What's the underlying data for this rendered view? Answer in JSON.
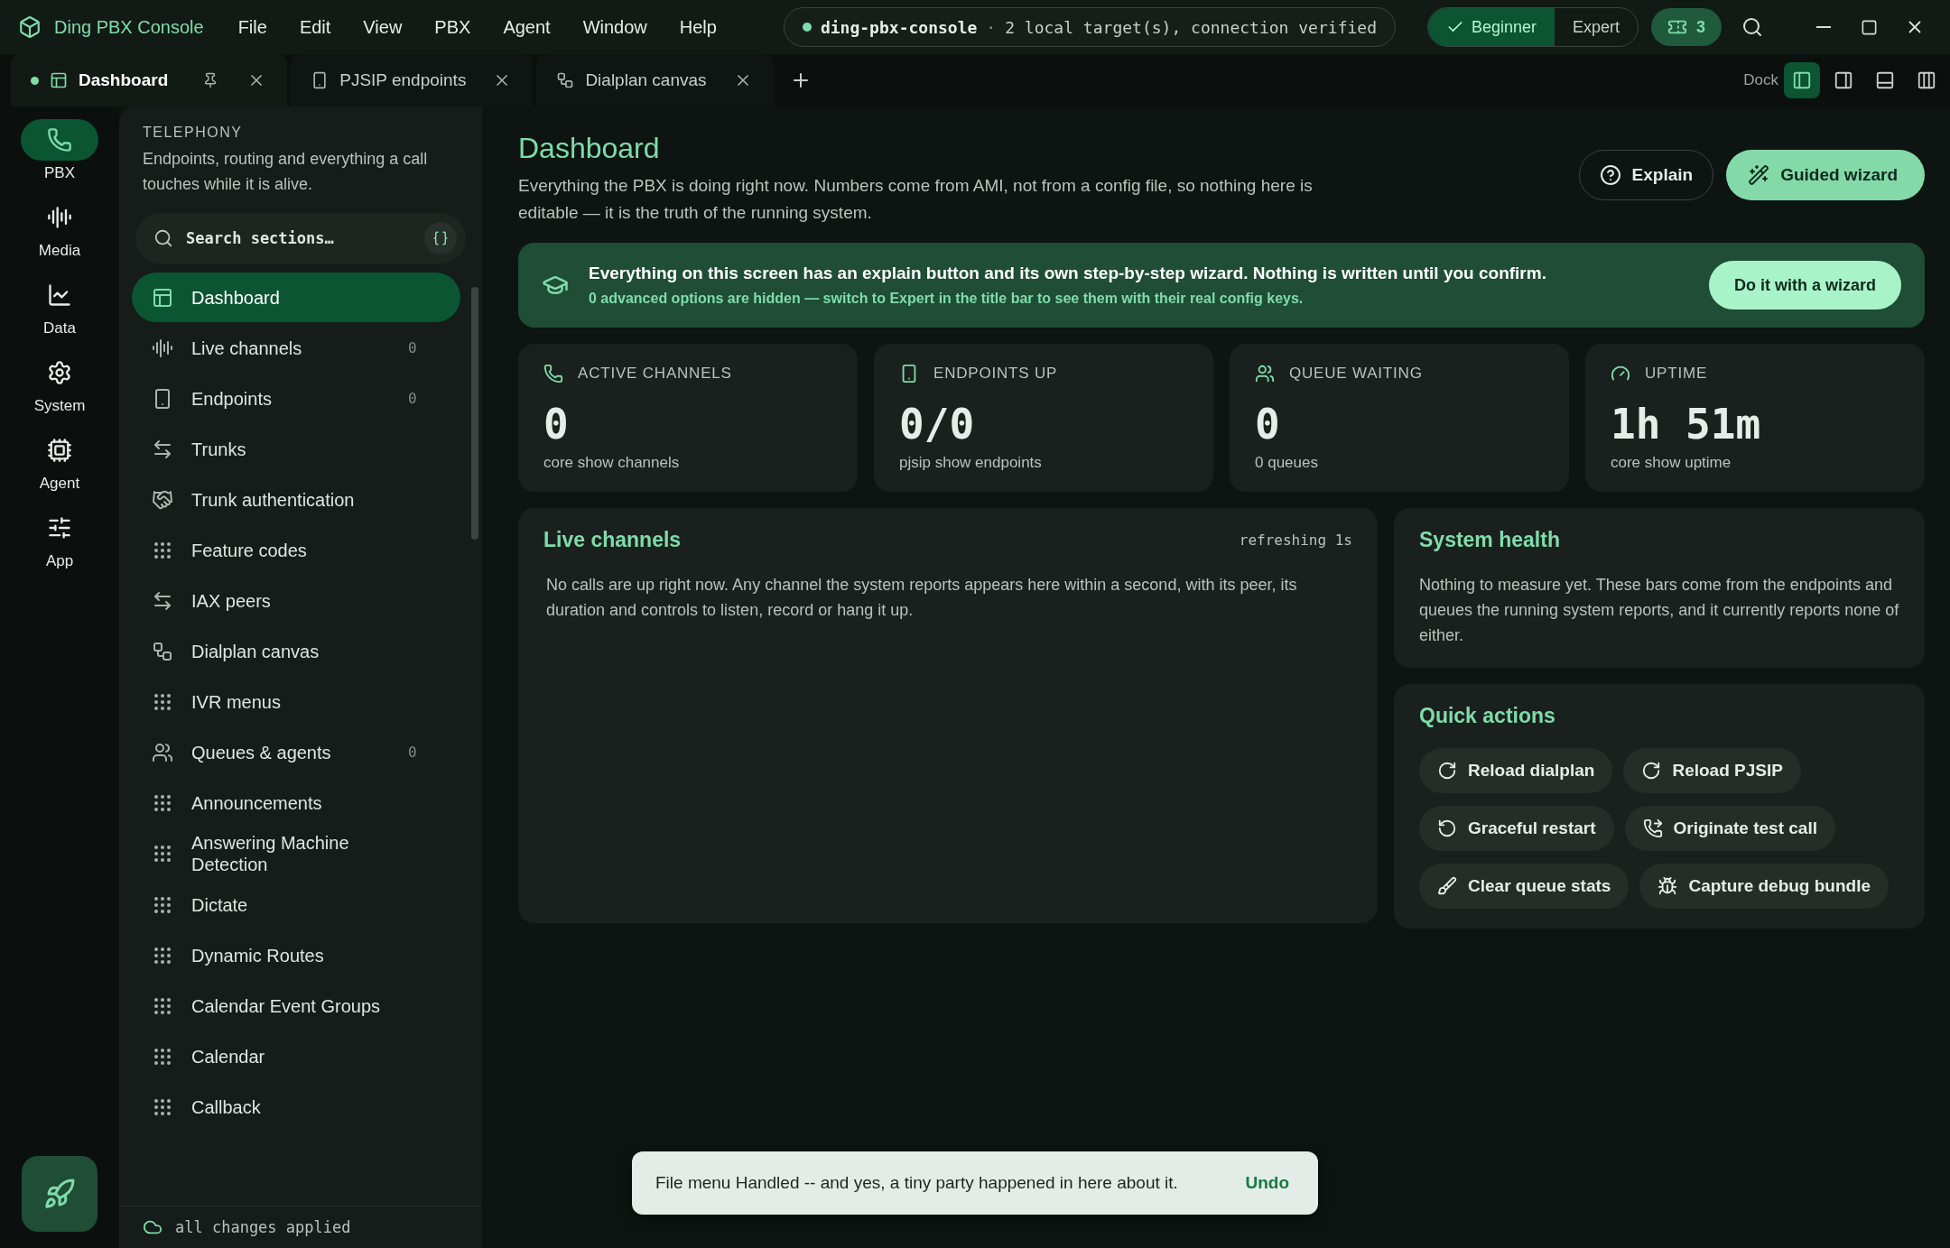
{
  "app": {
    "title": "Ding PBX Console"
  },
  "menu": [
    "File",
    "Edit",
    "View",
    "PBX",
    "Agent",
    "Window",
    "Help"
  ],
  "connection": {
    "name": "ding-pbx-console",
    "separator": "·",
    "status": "2 local target(s), connection verified",
    "online": true
  },
  "mode_toggle": [
    {
      "label": "Beginner",
      "selected": true
    },
    {
      "label": "Expert",
      "selected": false
    }
  ],
  "ticket_count": "3",
  "tabs": [
    {
      "label": "Dashboard",
      "selected": true,
      "unsaved": true,
      "pinned": true
    },
    {
      "label": "PJSIP endpoints",
      "selected": false,
      "unsaved": false,
      "pinned": false
    },
    {
      "label": "Dialplan canvas",
      "selected": false,
      "unsaved": false,
      "pinned": false
    }
  ],
  "dock": {
    "label": "Dock",
    "options": [
      {
        "selected": true
      },
      {
        "selected": false
      },
      {
        "selected": false
      },
      {
        "selected": false
      }
    ]
  },
  "rail": [
    {
      "label": "PBX",
      "selected": true
    },
    {
      "label": "Media",
      "selected": false
    },
    {
      "label": "Data",
      "selected": false
    },
    {
      "label": "System",
      "selected": false
    },
    {
      "label": "Agent",
      "selected": false
    },
    {
      "label": "App",
      "selected": false
    }
  ],
  "sidebar": {
    "section": "TELEPHONY",
    "description": "Endpoints, routing and everything a call touches while it is alive.",
    "search_placeholder": "Search sections…",
    "items": [
      {
        "label": "Dashboard",
        "selected": true
      },
      {
        "label": "Live channels",
        "selected": false,
        "count": "0"
      },
      {
        "label": "Endpoints",
        "selected": false,
        "count": "0"
      },
      {
        "label": "Trunks",
        "selected": false
      },
      {
        "label": "Trunk authentication",
        "selected": false
      },
      {
        "label": "Feature codes",
        "selected": false
      },
      {
        "label": "IAX peers",
        "selected": false
      },
      {
        "label": "Dialplan canvas",
        "selected": false
      },
      {
        "label": "IVR menus",
        "selected": false
      },
      {
        "label": "Queues & agents",
        "selected": false,
        "count": "0"
      },
      {
        "label": "Announcements",
        "selected": false
      },
      {
        "label": "Answering Machine Detection",
        "selected": false
      },
      {
        "label": "Dictate",
        "selected": false
      },
      {
        "label": "Dynamic Routes",
        "selected": false
      },
      {
        "label": "Calendar Event Groups",
        "selected": false
      },
      {
        "label": "Calendar",
        "selected": false
      },
      {
        "label": "Callback",
        "selected": false
      }
    ],
    "footer": "all changes applied"
  },
  "page": {
    "title": "Dashboard",
    "description": "Everything the PBX is doing right now. Numbers come from AMI, not from a config file, so nothing here is editable — it is the truth of the running system.",
    "buttons": [
      "Explain",
      "Guided wizard"
    ]
  },
  "banner": {
    "text": "Everything on this screen has an explain button and its own step-by-step wizard. Nothing is written until you confirm.",
    "note": "0 advanced options are hidden — switch to Expert in the title bar to see them with their real config keys.",
    "button": "Do it with a wizard"
  },
  "stats": [
    {
      "label": "ACTIVE CHANNELS",
      "value": "0",
      "caption": "core show channels"
    },
    {
      "label": "ENDPOINTS UP",
      "value": "0/0",
      "caption": "pjsip show endpoints"
    },
    {
      "label": "QUEUE WAITING",
      "value": "0",
      "caption": "0 queues"
    },
    {
      "label": "UPTIME",
      "value": "1h 51m",
      "caption": "core show uptime"
    }
  ],
  "live_channels": {
    "title": "Live channels",
    "status": "refreshing 1s",
    "message": "No calls are up right now. Any channel the system reports appears here within a second, with its peer, its duration and controls to listen, record or hang it up."
  },
  "system_health": {
    "title": "System health",
    "message": "Nothing to measure yet. These bars come from the endpoints and queues the running system reports, and it currently reports none of either."
  },
  "quick_actions": {
    "title": "Quick actions",
    "actions": [
      "Reload dialplan",
      "Reload PJSIP",
      "Graceful restart",
      "Originate test call",
      "Clear queue stats",
      "Capture debug bundle"
    ]
  },
  "toast": {
    "message": "File menu Handled -- and yes, a tiny party happened in here about it.",
    "action": "Undo"
  }
}
